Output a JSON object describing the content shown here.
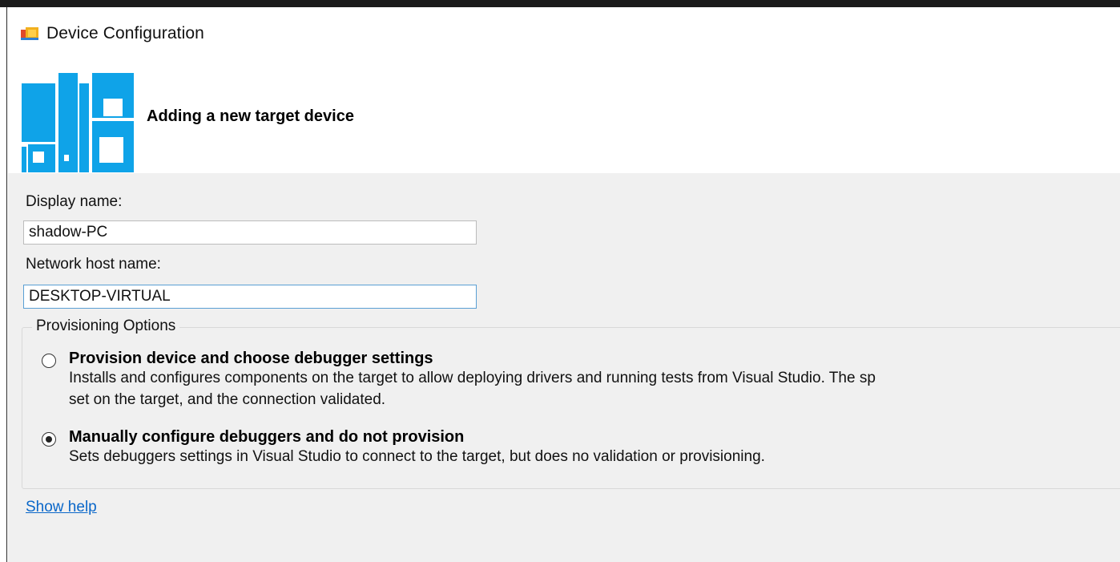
{
  "window": {
    "title": "Device Configuration",
    "icon": "window-app-icon"
  },
  "banner": {
    "heading": "Adding a new target device",
    "art": "device-banner-art"
  },
  "form": {
    "display_name_label": "Display name:",
    "display_name_value": "shadow-PC",
    "host_name_label": "Network host name:",
    "host_name_value": "DESKTOP-VIRTUAL"
  },
  "provisioning": {
    "legend": "Provisioning Options",
    "options": [
      {
        "title": "Provision device and choose debugger settings",
        "desc_line1": "Installs and configures components on the target to allow deploying drivers and running tests from Visual Studio. The sp",
        "desc_line2": "set on the target, and the connection validated.",
        "selected": false
      },
      {
        "title": "Manually configure debuggers and do not provision",
        "desc_line1": "Sets debuggers settings in Visual Studio to connect to the target, but does no validation or provisioning.",
        "selected": true
      }
    ]
  },
  "links": {
    "show_help": "Show help"
  },
  "colors": {
    "accent_blue": "#0fa3e8",
    "link": "#0a67c9",
    "panel_bg": "#f0f0f0",
    "focus_border": "#5a9fd4"
  }
}
